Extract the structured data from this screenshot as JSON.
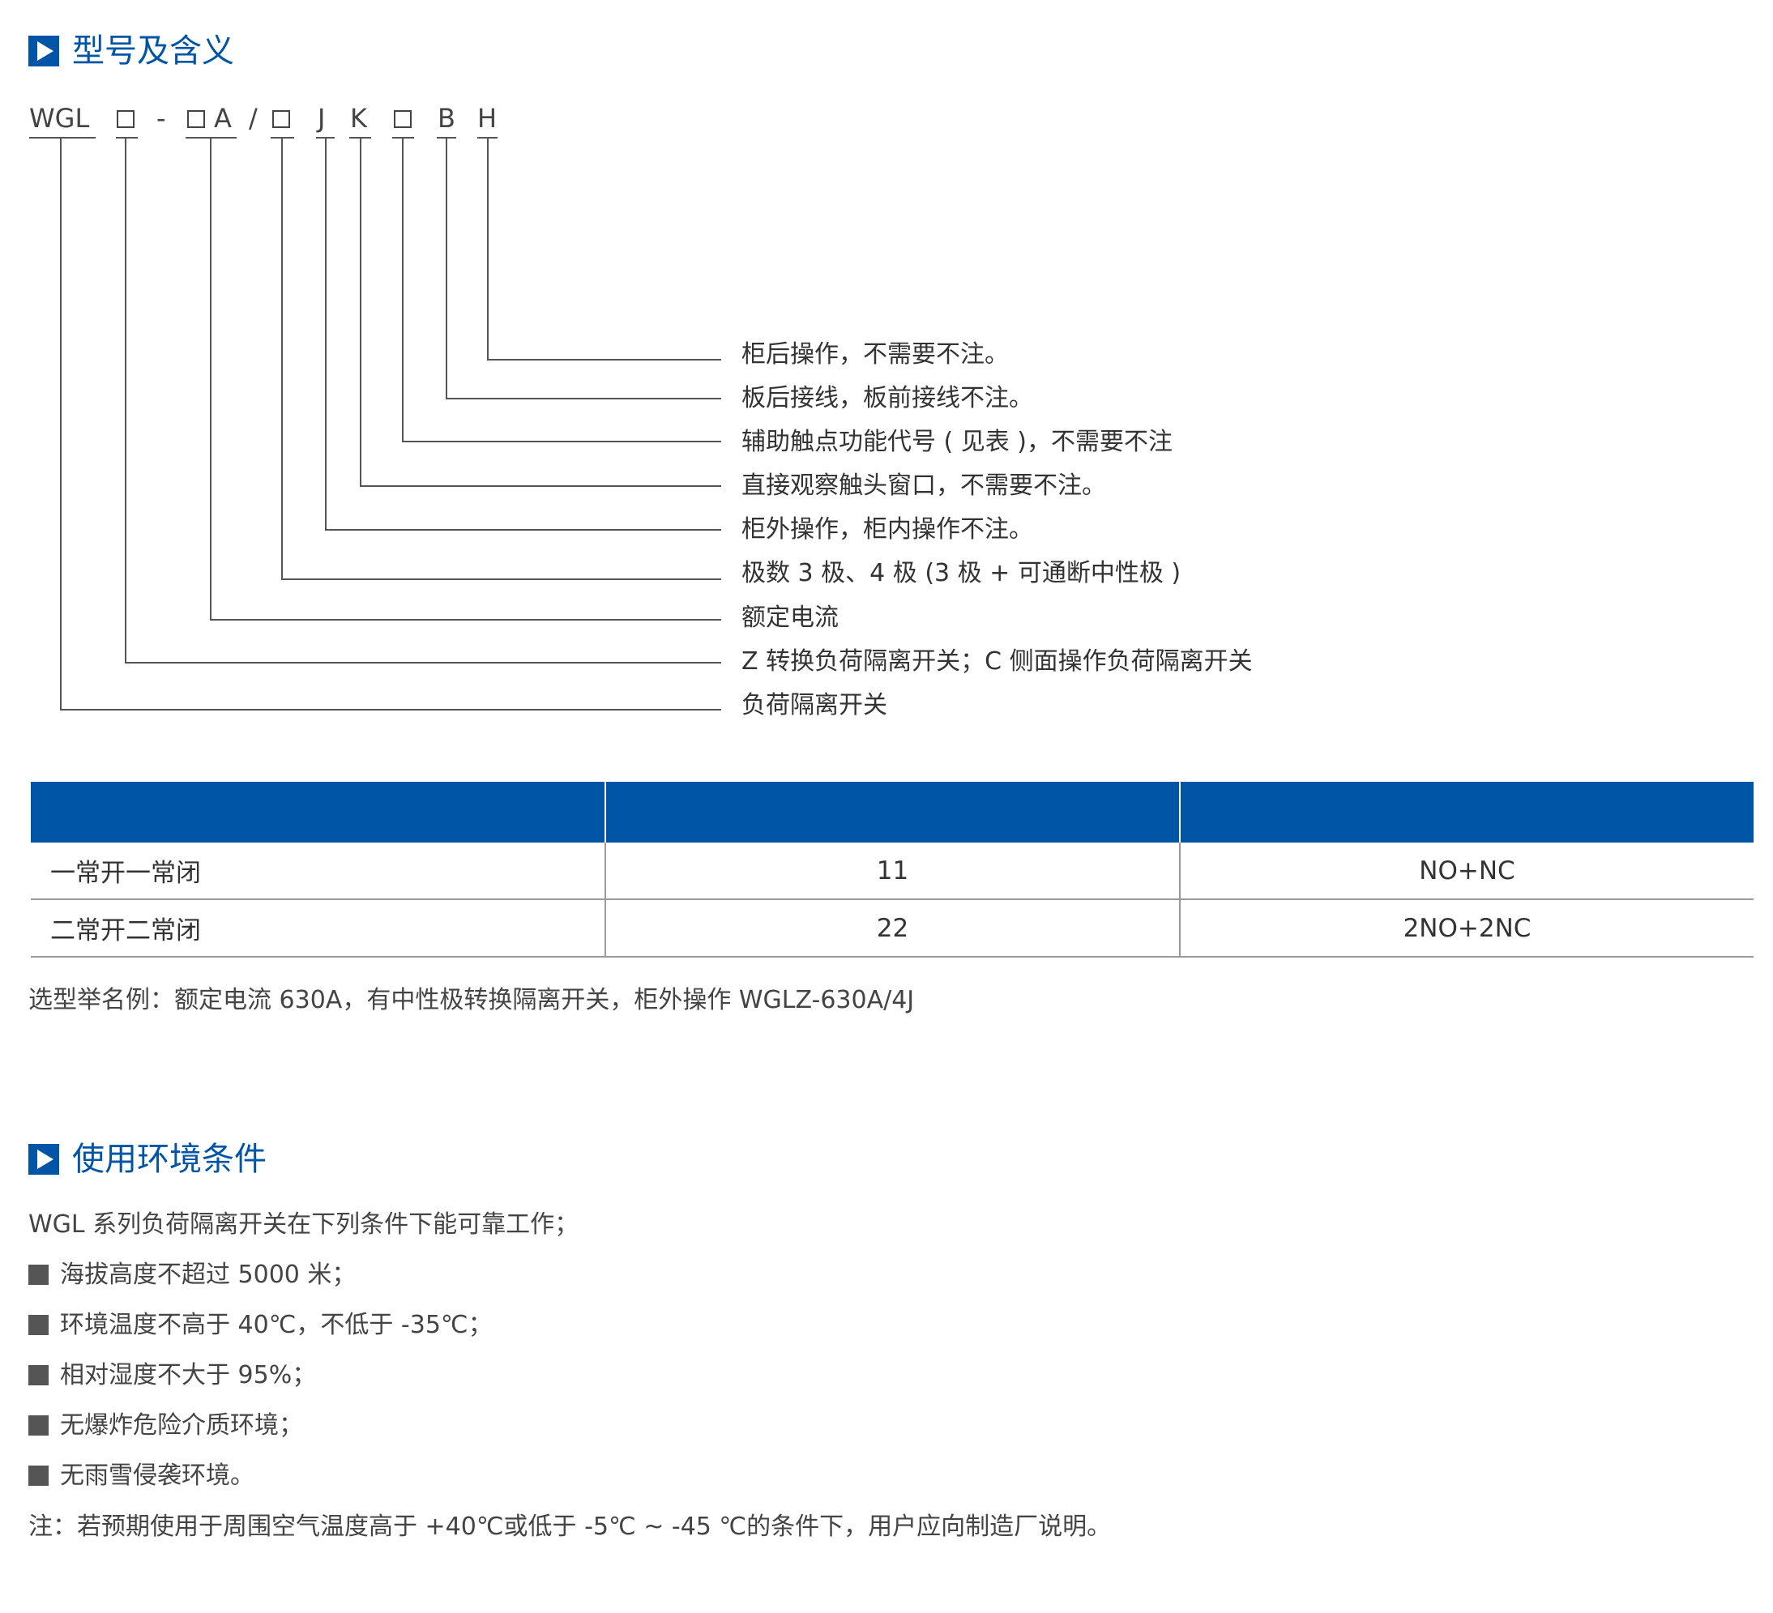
{
  "section1": {
    "title": "型号及含义"
  },
  "model_code": {
    "wgl": "WGL",
    "dash": "-",
    "a": "A",
    "slash": "/",
    "j": "J",
    "k": "K",
    "b": "B",
    "h": "H"
  },
  "meanings": [
    "柜后操作，不需要不注。",
    "板后接线，板前接线不注。",
    "辅助触点功能代号 ( 见表 )，不需要不注",
    "直接观察触头窗口，不需要不注。",
    "柜外操作，柜内操作不注。",
    "极数 3 极、4 极 (3 极 + 可通断中性极 )",
    "额定电流",
    "Z 转换负荷隔离开关；C 侧面操作负荷隔离开关",
    "负荷隔离开关"
  ],
  "table": {
    "rows": [
      [
        "一常开一常闭",
        "11",
        "NO+NC"
      ],
      [
        "二常开二常闭",
        "22",
        "2NO+2NC"
      ]
    ]
  },
  "example": "选型举名例：额定电流 630A，有中性极转换隔离开关，柜外操作 WGLZ-630A/4J",
  "section2": {
    "title": "使用环境条件"
  },
  "env_intro": "WGL 系列负荷隔离开关在下列条件下能可靠工作；",
  "env_items": [
    "海拔高度不超过 5000 米；",
    "环境温度不高于 40℃，不低于 -35℃；",
    "相对湿度不大于 95%；",
    "无爆炸危险介质环境；",
    "无雨雪侵袭环境。"
  ],
  "note": "注：若预期使用于周围空气温度高于 +40℃或低于 -5℃ ~ -45 ℃的条件下，用户应向制造厂说明。",
  "colors": {
    "accent": "#0055a6",
    "text": "#333333",
    "line": "#555555"
  }
}
